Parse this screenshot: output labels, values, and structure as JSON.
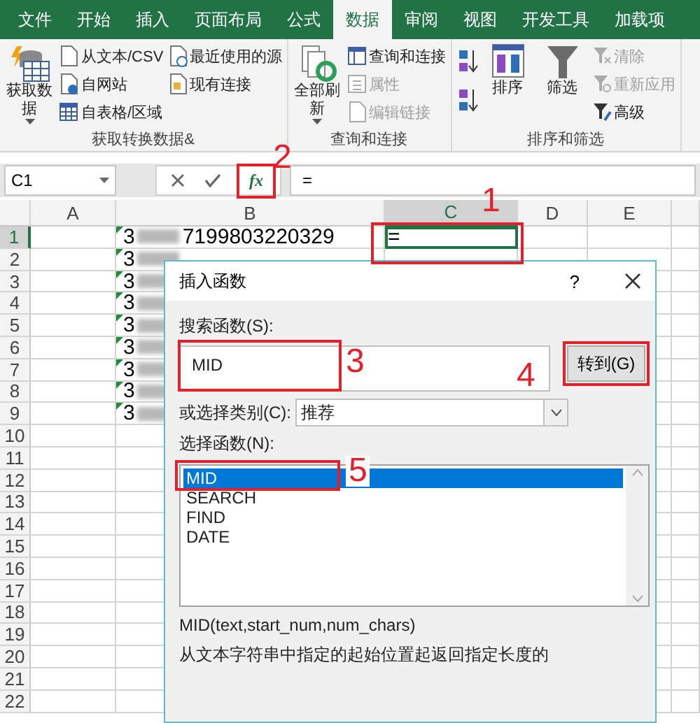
{
  "tabs": [
    {
      "label": "文件",
      "selected": false
    },
    {
      "label": "开始",
      "selected": false
    },
    {
      "label": "插入",
      "selected": false
    },
    {
      "label": "页面布局",
      "selected": false
    },
    {
      "label": "公式",
      "selected": false
    },
    {
      "label": "数据",
      "selected": true
    },
    {
      "label": "审阅",
      "selected": false
    },
    {
      "label": "视图",
      "selected": false
    },
    {
      "label": "开发工具",
      "selected": false
    },
    {
      "label": "加载项",
      "selected": false
    }
  ],
  "ribbon_groups": [
    {
      "label": "获取转换数据&",
      "columns": [
        [
          {
            "kind": "large",
            "label": "获取数据",
            "has_menu": true,
            "disabled": false
          }
        ],
        [
          {
            "kind": "small",
            "label": "从文本/CSV",
            "disabled": false
          },
          {
            "kind": "small",
            "label": "自网站",
            "disabled": false
          },
          {
            "kind": "small",
            "label": "自表格/区域",
            "disabled": false
          }
        ],
        [
          {
            "kind": "small",
            "label": "最近使用的源",
            "disabled": false
          },
          {
            "kind": "small",
            "label": "现有连接",
            "disabled": false
          }
        ]
      ]
    },
    {
      "label": "查询和连接",
      "columns": [
        [
          {
            "kind": "large",
            "label": "全部刷新",
            "has_menu": true,
            "disabled": false
          }
        ],
        [
          {
            "kind": "small",
            "label": "查询和连接",
            "disabled": false
          },
          {
            "kind": "small",
            "label": "属性",
            "disabled": true
          },
          {
            "kind": "small",
            "label": "编辑链接",
            "disabled": true
          }
        ]
      ]
    },
    {
      "label": "排序和筛选",
      "columns": [
        [
          {
            "kind": "icon",
            "disabled": false
          },
          {
            "kind": "icon",
            "disabled": false
          }
        ],
        [
          {
            "kind": "large",
            "label": "排序",
            "has_menu": false,
            "disabled": false
          }
        ],
        [
          {
            "kind": "large",
            "label": "筛选",
            "has_menu": false,
            "disabled": false
          }
        ],
        [
          {
            "kind": "small",
            "label": "清除",
            "disabled": true
          },
          {
            "kind": "small",
            "label": "重新应用",
            "disabled": true
          },
          {
            "kind": "small",
            "label": "高级",
            "disabled": false
          }
        ]
      ]
    }
  ],
  "formula_bar": {
    "name_box": "C1",
    "fx_label": "fx",
    "formula": "="
  },
  "sheet": {
    "columns": [
      {
        "label": "A",
        "selected": false
      },
      {
        "label": "B",
        "selected": false
      },
      {
        "label": "C",
        "selected": true
      },
      {
        "label": "D",
        "selected": false
      },
      {
        "label": "E",
        "selected": false
      }
    ],
    "rows": [
      {
        "number": "1",
        "selected": true,
        "b_lead": "3",
        "b_redacted": true,
        "b_text": "7199803220329",
        "c_text": "="
      },
      {
        "number": "2",
        "selected": false,
        "b_lead": "3",
        "b_redacted": true
      },
      {
        "number": "3",
        "selected": false,
        "b_lead": "3",
        "b_redacted": true
      },
      {
        "number": "4",
        "selected": false,
        "b_lead": "3",
        "b_redacted": true
      },
      {
        "number": "5",
        "selected": false,
        "b_lead": "3",
        "b_redacted": true
      },
      {
        "number": "6",
        "selected": false,
        "b_lead": "3",
        "b_redacted": true
      },
      {
        "number": "7",
        "selected": false,
        "b_lead": "3",
        "b_redacted": true
      },
      {
        "number": "8",
        "selected": false,
        "b_lead": "3",
        "b_redacted": true
      },
      {
        "number": "9",
        "selected": false,
        "b_lead": "3",
        "b_redacted": true
      },
      {
        "number": "10",
        "selected": false
      },
      {
        "number": "11",
        "selected": false
      },
      {
        "number": "12",
        "selected": false
      },
      {
        "number": "13",
        "selected": false
      },
      {
        "number": "14",
        "selected": false
      },
      {
        "number": "15",
        "selected": false
      },
      {
        "number": "16",
        "selected": false
      },
      {
        "number": "17",
        "selected": false
      },
      {
        "number": "18",
        "selected": false
      },
      {
        "number": "19",
        "selected": false
      },
      {
        "number": "20",
        "selected": false
      },
      {
        "number": "21",
        "selected": false
      },
      {
        "number": "22",
        "selected": false
      }
    ]
  },
  "dialog": {
    "title": "插入函数",
    "help": "?",
    "search_label": "搜索函数(S):",
    "search_value": "MID",
    "go_button": "转到(G)",
    "category_label": "或选择类别(C):",
    "category_value": "推荐",
    "list_label": "选择函数(N):",
    "functions": [
      {
        "name": "MID",
        "selected": true
      },
      {
        "name": "SEARCH",
        "selected": false
      },
      {
        "name": "FIND",
        "selected": false
      },
      {
        "name": "DATE",
        "selected": false
      }
    ],
    "signature": "MID(text,start_num,num_chars)",
    "description": "从文本字符串中指定的起始位置起返回指定长度的"
  },
  "annotations": [
    {
      "number": "1"
    },
    {
      "number": "2"
    },
    {
      "number": "3"
    },
    {
      "number": "4"
    },
    {
      "number": "5"
    }
  ]
}
